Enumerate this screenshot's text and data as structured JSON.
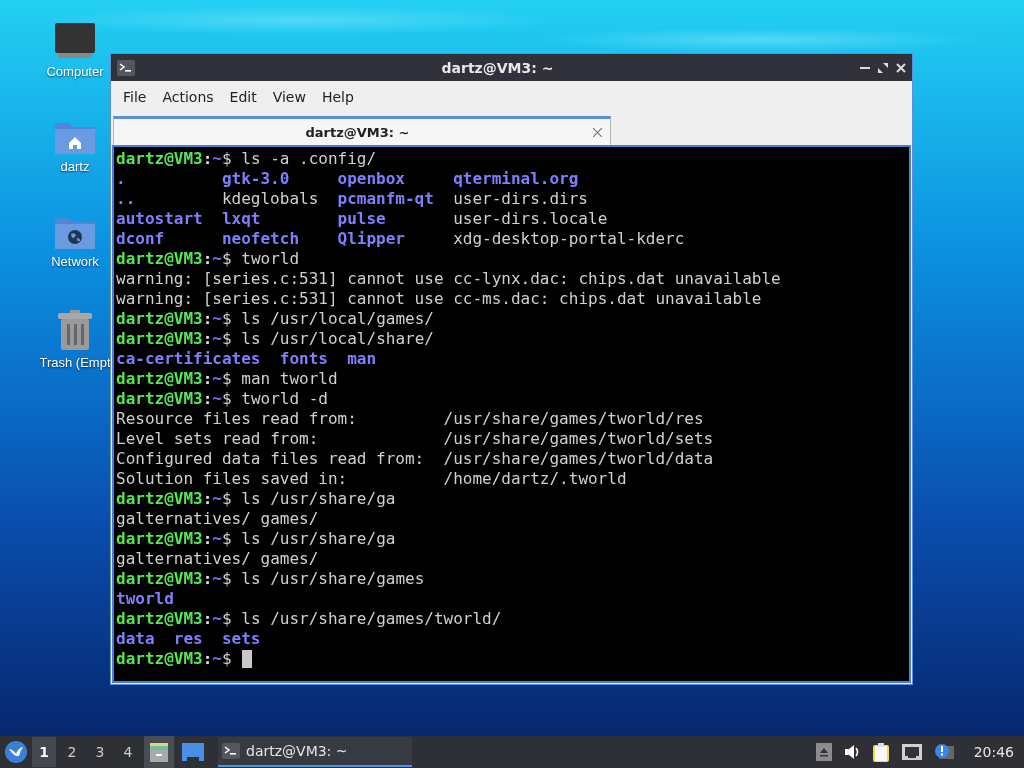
{
  "desktop_icons": [
    {
      "kind": "computer",
      "label": "Computer"
    },
    {
      "kind": "home",
      "label": "dartz"
    },
    {
      "kind": "network",
      "label": "Network"
    },
    {
      "kind": "trash",
      "label": "Trash (Empt"
    }
  ],
  "window": {
    "title": "dartz@VM3: ~",
    "menu": [
      "File",
      "Actions",
      "Edit",
      "View",
      "Help"
    ],
    "tabs": [
      {
        "label": "dartz@VM3: ~",
        "selected": true
      }
    ],
    "terminal": [
      {
        "kind": "prompt",
        "user": "dartz@VM3",
        "sep": ":",
        "path": "~",
        "symbol": "$",
        "command": "ls -a .config/"
      },
      {
        "kind": "listing",
        "rows": [
          [
            {
              "name": ".",
              "dir": true
            },
            {
              "name": "gtk-3.0",
              "dir": true
            },
            {
              "name": "openbox",
              "dir": true
            },
            {
              "name": "qterminal.org",
              "dir": true
            }
          ],
          [
            {
              "name": "..",
              "dir": true
            },
            {
              "name": "kdeglobals",
              "dir": false
            },
            {
              "name": "pcmanfm-qt",
              "dir": true
            },
            {
              "name": "user-dirs.dirs",
              "dir": false
            }
          ],
          [
            {
              "name": "autostart",
              "dir": true
            },
            {
              "name": "lxqt",
              "dir": true
            },
            {
              "name": "pulse",
              "dir": true
            },
            {
              "name": "user-dirs.locale",
              "dir": false
            }
          ],
          [
            {
              "name": "dconf",
              "dir": true
            },
            {
              "name": "neofetch",
              "dir": true
            },
            {
              "name": "Qlipper",
              "dir": true
            },
            {
              "name": "xdg-desktop-portal-kderc",
              "dir": false
            }
          ]
        ]
      },
      {
        "kind": "prompt",
        "user": "dartz@VM3",
        "sep": ":",
        "path": "~",
        "symbol": "$",
        "command": "tworld"
      },
      {
        "kind": "text",
        "text": "warning: [series.c:531] cannot use cc-lynx.dac: chips.dat unavailable"
      },
      {
        "kind": "text",
        "text": "warning: [series.c:531] cannot use cc-ms.dac: chips.dat unavailable"
      },
      {
        "kind": "prompt",
        "user": "dartz@VM3",
        "sep": ":",
        "path": "~",
        "symbol": "$",
        "command": "ls /usr/local/games/"
      },
      {
        "kind": "prompt",
        "user": "dartz@VM3",
        "sep": ":",
        "path": "~",
        "symbol": "$",
        "command": "ls /usr/local/share/"
      },
      {
        "kind": "listing",
        "rows": [
          [
            {
              "name": "ca-certificates",
              "dir": true
            },
            {
              "name": "fonts",
              "dir": true
            },
            {
              "name": "man",
              "dir": true
            }
          ]
        ]
      },
      {
        "kind": "prompt",
        "user": "dartz@VM3",
        "sep": ":",
        "path": "~",
        "symbol": "$",
        "command": "man tworld"
      },
      {
        "kind": "prompt",
        "user": "dartz@VM3",
        "sep": ":",
        "path": "~",
        "symbol": "$",
        "command": "tworld -d"
      },
      {
        "kind": "fields",
        "items": [
          {
            "label": "Resource files read from:",
            "value": "/usr/share/games/tworld/res"
          },
          {
            "label": "Level sets read from:",
            "value": "/usr/share/games/tworld/sets"
          },
          {
            "label": "Configured data files read from:",
            "value": "/usr/share/games/tworld/data"
          },
          {
            "label": "Solution files saved in:",
            "value": "/home/dartz/.tworld"
          }
        ]
      },
      {
        "kind": "prompt",
        "user": "dartz@VM3",
        "sep": ":",
        "path": "~",
        "symbol": "$",
        "command": "ls /usr/share/ga"
      },
      {
        "kind": "text",
        "text": "galternatives/ games/"
      },
      {
        "kind": "prompt",
        "user": "dartz@VM3",
        "sep": ":",
        "path": "~",
        "symbol": "$",
        "command": "ls /usr/share/ga"
      },
      {
        "kind": "text",
        "text": "galternatives/ games/"
      },
      {
        "kind": "prompt",
        "user": "dartz@VM3",
        "sep": ":",
        "path": "~",
        "symbol": "$",
        "command": "ls /usr/share/games"
      },
      {
        "kind": "listing",
        "rows": [
          [
            {
              "name": "tworld",
              "dir": true
            }
          ]
        ]
      },
      {
        "kind": "prompt",
        "user": "dartz@VM3",
        "sep": ":",
        "path": "~",
        "symbol": "$",
        "command": "ls /usr/share/games/tworld/"
      },
      {
        "kind": "listing",
        "rows": [
          [
            {
              "name": "data",
              "dir": true
            },
            {
              "name": "res",
              "dir": true
            },
            {
              "name": "sets",
              "dir": true
            }
          ]
        ]
      },
      {
        "kind": "prompt",
        "user": "dartz@VM3",
        "sep": ":",
        "path": "~",
        "symbol": "$",
        "cursor": true
      }
    ]
  },
  "taskbar": {
    "workspaces": [
      {
        "label": "1",
        "selected": true
      },
      {
        "label": "2",
        "selected": false
      },
      {
        "label": "3",
        "selected": false
      },
      {
        "label": "4",
        "selected": false
      }
    ],
    "tasks": [
      {
        "label": "dartz@VM3: ~",
        "selected": true
      }
    ],
    "clock": "20:46"
  }
}
